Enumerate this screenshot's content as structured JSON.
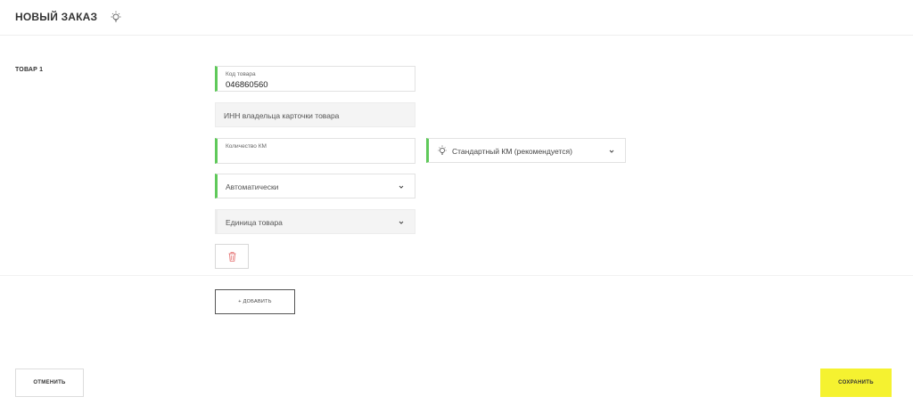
{
  "header": {
    "title": "НОВЫЙ ЗАКАЗ",
    "hint_icon": "lightbulb-icon"
  },
  "product": {
    "section_label": "ТОВАР 1",
    "code_field": {
      "caption": "Код товара",
      "value": "046860560"
    },
    "inn_field": {
      "placeholder": "ИНН владельца карточки товара"
    },
    "quantity_field": {
      "caption": "Количество КМ",
      "value": ""
    },
    "km_type_select": {
      "value": "Стандартный КМ (рекомендуется)",
      "icon": "lightbulb-icon"
    },
    "mode_select": {
      "value": "Автоматически"
    },
    "unit_select": {
      "placeholder": "Единица товара"
    },
    "delete_icon": "trash-icon"
  },
  "actions": {
    "add_label": "+ ДОБАВИТЬ",
    "cancel_label": "ОТМЕНИТЬ",
    "save_label": "СОХРАНИТЬ"
  },
  "colors": {
    "accent_green": "#5fc95a",
    "save_yellow": "#f5f230",
    "delete_red": "#e57373"
  }
}
